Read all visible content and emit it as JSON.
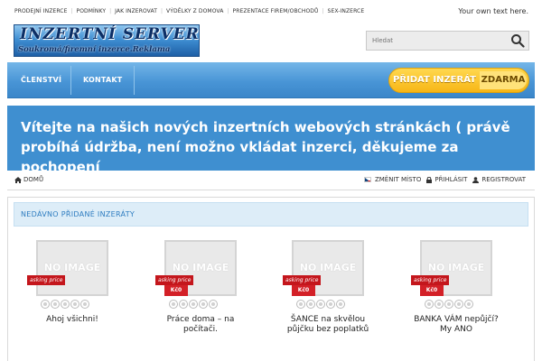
{
  "top_links": [
    "PRODEJNÍ INZERCE",
    "PODMÍNKY",
    "JAK INZEROVAT",
    "VÝDĚLKY Z DOMOVA",
    "PREZENTACE FIREM/OBCHODŮ",
    "SEX-INZERCE"
  ],
  "top_right_text": "Your own text here.",
  "logo": {
    "title": "INZERTNÍ SERVER",
    "subtitle": "Soukromá/firemní inzerce.Reklama"
  },
  "search": {
    "placeholder": "Hledat",
    "icon": "search-icon"
  },
  "nav": {
    "members": "ČLENSTVÍ",
    "contact": "KONTAKT"
  },
  "cta": {
    "left": "PŘIDAT INZERÁT",
    "right": "ZDARMA"
  },
  "banner": {
    "text": "Vítejte na našich nových inzertních webových stránkách ( právě probíhá údržba, není možno vkládat inzerci, děkujeme za pochopení"
  },
  "breadcrumb": {
    "home": "DOMŮ",
    "change_place": "ZMĚNIT MÍSTO",
    "login": "PŘIHLÁSIT",
    "register": "REGISTROVAT"
  },
  "recent": {
    "title": "NEDÁVNO PŘIDANÉ INZERÁTY",
    "listings": [
      {
        "image_text": "NO IMAGE",
        "price_label": "asking price",
        "price": "",
        "title": "Ahoj všichni!"
      },
      {
        "image_text": "NO IMAGE",
        "price_label": "asking price",
        "price": "Kč0",
        "title": "Práce doma – na počítači."
      },
      {
        "image_text": "NO IMAGE",
        "price_label": "asking price",
        "price": "Kč0",
        "title": "ŠANCE na skvělou půjčku bez poplatků"
      },
      {
        "image_text": "NO IMAGE",
        "price_label": "asking price",
        "price": "Kč0",
        "title": "BANKA VÁM nepůjčí? My ANO"
      }
    ]
  },
  "colors": {
    "accent_blue": "#3f8fd0",
    "cta_yellow": "#f7b616",
    "price_red": "#c4161c"
  }
}
